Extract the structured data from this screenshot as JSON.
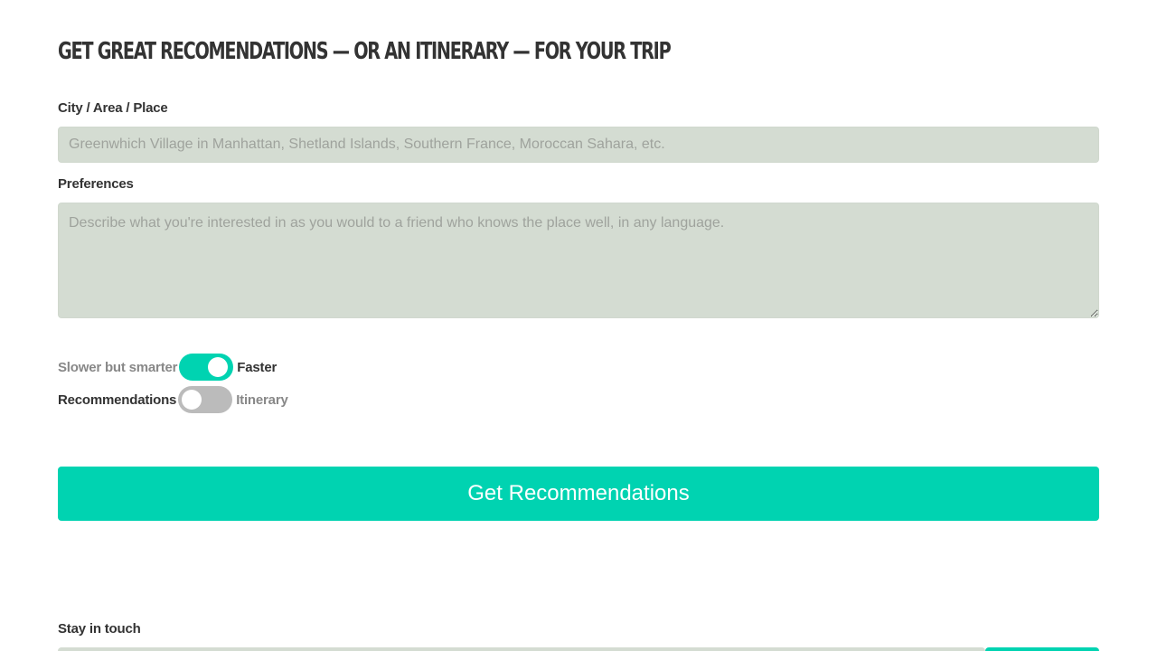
{
  "header": {
    "title": "Get great recomendations — or an itinerary — for your trip"
  },
  "form": {
    "place": {
      "label": "City / Area / Place",
      "placeholder": "Greenwhich Village in Manhattan, Shetland Islands, Southern France, Moroccan Sahara, etc.",
      "value": ""
    },
    "preferences": {
      "label": "Preferences",
      "placeholder": "Describe what you're interested in as you would to a friend who knows the place well, in any language.",
      "value": ""
    },
    "speed_toggle": {
      "left_label": "Slower but smarter",
      "right_label": "Faster",
      "state": "on",
      "selected": "Faster"
    },
    "mode_toggle": {
      "left_label": "Recommendations",
      "right_label": "Itinerary",
      "state": "off",
      "selected": "Recommendations"
    },
    "submit_label": "Get Recommendations"
  },
  "footer": {
    "stay_in_touch_label": "Stay in touch"
  },
  "colors": {
    "accent": "#00d3b1",
    "field_bg": "#d4dcd2",
    "toggle_off": "#bbbbbb",
    "text": "#333333",
    "text_muted": "#888888"
  }
}
